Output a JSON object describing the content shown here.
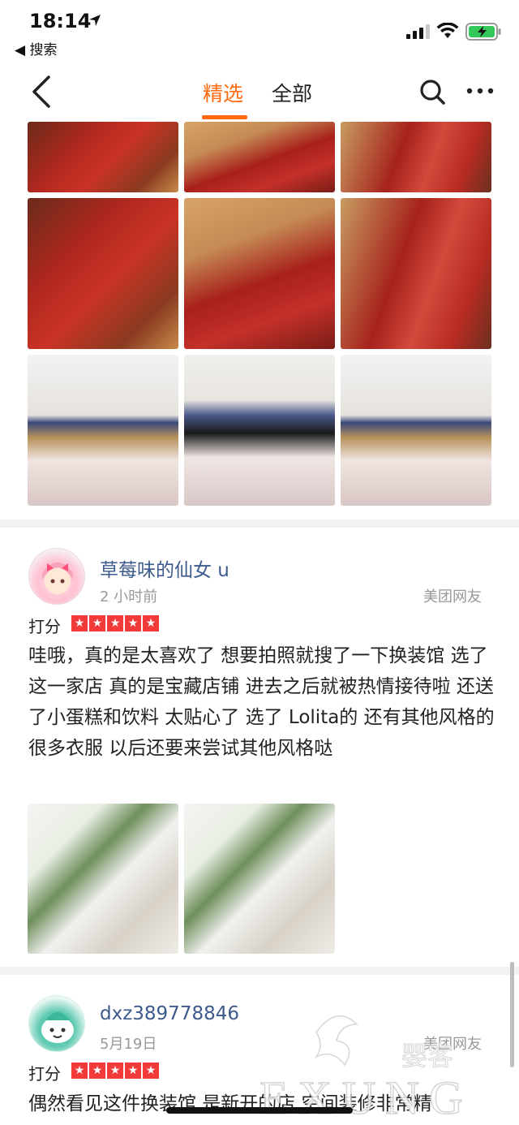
{
  "status_bar": {
    "time": "18:14",
    "back_app_label": "◀ 搜索"
  },
  "nav": {
    "tabs": [
      {
        "label": "精选",
        "selected": true
      },
      {
        "label": "全部",
        "selected": false
      }
    ],
    "accent_color": "#ff6a10"
  },
  "reviews": [
    {
      "username": "草莓味的仙女 u",
      "time_ago": "2 小时前",
      "source": "美团网友",
      "rating_label": "打分",
      "stars": 5,
      "text": "哇哦，真的是太喜欢了 想要拍照就搜了一下换装馆 选了这一家店 真的是宝藏店铺 进去之后就被热情接待啦 还送了小蛋糕和饮料 太贴心了 选了 Lolita的 还有其他风格的很多衣服 以后还要来尝试其他风格哒"
    },
    {
      "username": "dxz389778846",
      "time_ago": "5月19日",
      "source": "美团网友",
      "rating_label": "打分",
      "stars": 5,
      "text": "偶然看见这件换装馆 是新开的店 空间装修非常精"
    }
  ],
  "watermark": {
    "brand_en": "EXUNG",
    "brand_cn": "婴客"
  }
}
